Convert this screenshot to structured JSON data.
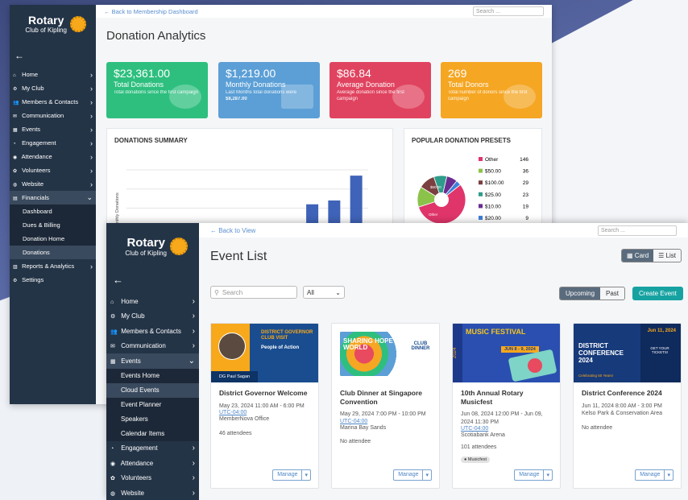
{
  "colors": {
    "sidebar": "#243447",
    "green": "#2ebf7f",
    "blue": "#5b9fd6",
    "red": "#e0435f",
    "orange": "#f5a623",
    "accent": "#17a2a2"
  },
  "window1": {
    "org_name": "Rotary",
    "org_sub": "Club of Kipling",
    "back_arrow": "←",
    "nav": [
      {
        "label": "Home",
        "icon": "home-icon"
      },
      {
        "label": "My Club",
        "icon": "gear-icon"
      },
      {
        "label": "Members & Contacts",
        "icon": "people-icon"
      },
      {
        "label": "Communication",
        "icon": "envelope-icon"
      },
      {
        "label": "Events",
        "icon": "calendar-icon"
      },
      {
        "label": "Engagement",
        "icon": "engagement-icon"
      },
      {
        "label": "Attendance",
        "icon": "attendance-icon"
      },
      {
        "label": "Volunteers",
        "icon": "volunteer-icon"
      },
      {
        "label": "Website",
        "icon": "globe-icon"
      },
      {
        "label": "Financials",
        "icon": "document-icon"
      }
    ],
    "financial_sub": [
      "Dashboard",
      "Dues & Billing",
      "Donation Home",
      "Donations"
    ],
    "nav_after": [
      {
        "label": "Reports & Analytics",
        "icon": "reports-icon"
      },
      {
        "label": "Settings",
        "icon": "gear-icon"
      }
    ],
    "back_link": "← Back to Membership Dashboard",
    "search_placeholder": "Search ...",
    "page_title": "Donation Analytics",
    "stats": [
      {
        "value": "$23,361.00",
        "label": "Total Donations",
        "desc": "Total donations since the first campaign"
      },
      {
        "value": "$1,219.00",
        "label": "Monthly Donations",
        "desc": "Last Months total donations were",
        "extra": "$8,287.00"
      },
      {
        "value": "$86.84",
        "label": "Average Donation",
        "desc": "Average donation since the first campaign"
      },
      {
        "value": "269",
        "label": "Total Donors",
        "desc": "Total number of donors since the first campaign"
      }
    ],
    "summary_title": "DONATIONS SUMMARY",
    "summary_ylabel": "Total Monthly Donations",
    "presets_title": "POPULAR DONATION PRESETS",
    "presets_slice_labels": [
      "$50.00",
      "Other"
    ]
  },
  "chart_data": [
    {
      "type": "bar",
      "title": "DONATIONS SUMMARY",
      "ylabel": "Total Monthly Donations",
      "values": [
        0,
        0,
        0,
        0,
        0,
        0,
        0,
        0.05,
        1.1,
        1.2,
        1.85
      ],
      "note": "values relative, axis ticks not visible"
    },
    {
      "type": "pie",
      "title": "POPULAR DONATION PRESETS",
      "categories": [
        "Other",
        "$50.00",
        "$100.00",
        "$25.00",
        "$10.00",
        "$20.00"
      ],
      "values": [
        146,
        36,
        29,
        23,
        19,
        9
      ],
      "colors": [
        "#e0356a",
        "#8bc34a",
        "#7b3f3f",
        "#2e9c8a",
        "#6a2c91",
        "#3f7fd8"
      ]
    }
  ],
  "window2": {
    "org_name": "Rotary",
    "org_sub": "Club of Kipling",
    "back_arrow": "←",
    "nav_before": [
      {
        "label": "Home",
        "icon": "home-icon"
      },
      {
        "label": "My Club",
        "icon": "gear-icon"
      },
      {
        "label": "Members & Contacts",
        "icon": "people-icon"
      },
      {
        "label": "Communication",
        "icon": "envelope-icon"
      },
      {
        "label": "Events",
        "icon": "calendar-icon"
      }
    ],
    "events_sub": [
      "Events Home",
      "Cloud Events",
      "Event Planner",
      "Speakers",
      "Calendar Items"
    ],
    "nav_after": [
      {
        "label": "Engagement",
        "icon": "engagement-icon"
      },
      {
        "label": "Attendance",
        "icon": "attendance-icon"
      },
      {
        "label": "Volunteers",
        "icon": "volunteer-icon"
      },
      {
        "label": "Website",
        "icon": "globe-icon"
      }
    ],
    "back_link": "← Back to View",
    "search_placeholder": "Search ...",
    "page_title": "Event List",
    "view_card": "Card",
    "view_list": "List",
    "filter_search_placeholder": "Search",
    "filter_select": "All",
    "tab_upcoming": "Upcoming",
    "tab_past": "Past",
    "create_event": "Create Event",
    "events": [
      {
        "title": "District Governor Welcome",
        "date": "May 23, 2024 11:00 AM - 6:00 PM",
        "tz": "UTC-04:00",
        "location": "MemberNova Office",
        "attendees": "46 attendees",
        "tag": "",
        "manage": "Manage",
        "banner": {
          "heading": "DISTRICT GOVERNOR CLUB VISIT",
          "sub": "People of Action",
          "person": "DG Paul Sagan"
        }
      },
      {
        "title": "Club Dinner at Singapore Convention",
        "date": "May 29, 2024 7:00 PM - 10:00 PM",
        "tz": "UTC-04:00",
        "location": "Marina Bay Sands",
        "attendees": "No attendee",
        "tag": "",
        "manage": "Manage",
        "banner": {
          "heading": "SHARING HOPE WITH THE WORLD",
          "sub": "CLUB DINNER"
        }
      },
      {
        "title": "10th Annual Rotary Musicfest",
        "date": "Jun 08, 2024 12:00 PM - Jun 09, 2024 11:30 PM",
        "tz": "UTC-04:00",
        "location": "Scotiabank Arena",
        "attendees": "101 attendees",
        "tag": "Musicfest",
        "manage": "Manage",
        "banner": {
          "heading": "MUSIC FESTIVAL",
          "sub": "JUN 8 - 9, 2024",
          "year": "2024"
        }
      },
      {
        "title": "District Conference 2024",
        "date": "Jun 11, 2024 8:00 AM - 3:00 PM",
        "tz": "",
        "location": "Kelso Park & Conservation Area",
        "attendees": "No attendee",
        "tag": "",
        "manage": "Manage",
        "banner": {
          "heading": "DISTRICT CONFERENCE 2024",
          "sub": "Jun 11, 2024",
          "tickets": "GET YOUR TICKETS!",
          "tagline": "Celebrating 50 Years!"
        }
      }
    ]
  }
}
